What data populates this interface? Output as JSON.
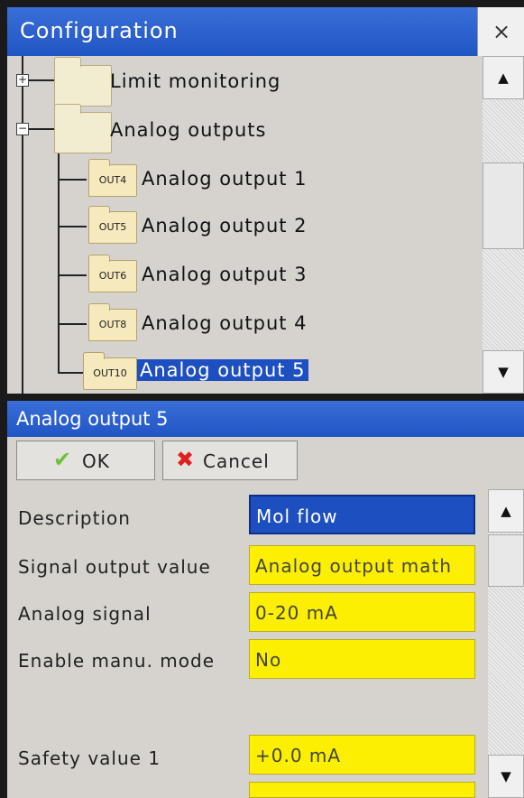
{
  "config_window": {
    "title": "Configuration",
    "close_label": "×",
    "tree": {
      "limit_monitoring": "Limit monitoring",
      "analog_outputs": "Analog outputs",
      "items": [
        {
          "tag": "OUT4",
          "label": "Analog output 1"
        },
        {
          "tag": "OUT5",
          "label": "Analog output 2"
        },
        {
          "tag": "OUT6",
          "label": "Analog output 3"
        },
        {
          "tag": "OUT8",
          "label": "Analog output 4"
        },
        {
          "tag": "OUT10",
          "label": "Analog output 5"
        }
      ],
      "expand_symbol": "+",
      "collapse_symbol": "−"
    },
    "scroll_up": "▲",
    "scroll_down": "▼"
  },
  "dialog": {
    "title": "Analog output 5",
    "ok_label": "OK",
    "ok_icon": "✔",
    "cancel_label": "Cancel",
    "cancel_icon": "✖",
    "rows": [
      {
        "label": "Description",
        "value": "Mol flow"
      },
      {
        "label": "Signal output value",
        "value": "Analog output math"
      },
      {
        "label": "Analog signal",
        "value": "0-20 mA"
      },
      {
        "label": "Enable manu. mode",
        "value": "No"
      },
      {
        "label": "Safety value 1",
        "value": "+0.0 mA"
      }
    ],
    "scroll_up": "▲",
    "scroll_down": "▼"
  },
  "icons": {
    "close": "close-icon",
    "ok": "checkmark-icon",
    "cancel": "x-icon",
    "folder": "folder-icon"
  },
  "colors": {
    "titlebar": "#2a60cc",
    "selection": "#1d4fc1",
    "field_yellow": "#fcf000",
    "ok_green": "#6bc23a",
    "cancel_red": "#e02020"
  }
}
